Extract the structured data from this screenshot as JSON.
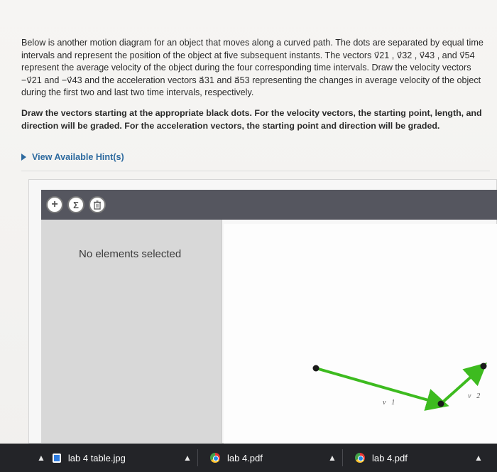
{
  "problem": {
    "intro": "Below is another motion diagram for an object that moves along a curved path. The dots are separated by equal time intervals and represent the position of the object at five subsequent instants. The vectors v⃗21 , v⃗32 , v⃗43 , and v⃗54 represent the average velocity of the object during the four corresponding time intervals. Draw the velocity vectors −v⃗21 and −v⃗43 and the acceleration vectors a⃗31 and a⃗53 representing the changes in average velocity of the object during the first two and last two time intervals, respectively.",
    "task": "Draw the vectors starting at the appropriate black dots. For the velocity vectors, the starting point, length, and direction will be graded. For the acceleration vectors, the starting point and direction will be graded.",
    "hint_label": "View Available Hint(s)"
  },
  "tool": {
    "add_icon": "+",
    "sum_icon": "Σ",
    "trash_icon": "trash-icon",
    "empty_message": "No elements selected"
  },
  "canvas": {
    "vector_color": "#3dbb1f",
    "label_v1": "v⃗1",
    "label_v2": "v⃗2"
  },
  "taskbar": {
    "item1": "lab 4 table.jpg",
    "item2": "lab 4.pdf",
    "item3": "lab 4.pdf"
  }
}
